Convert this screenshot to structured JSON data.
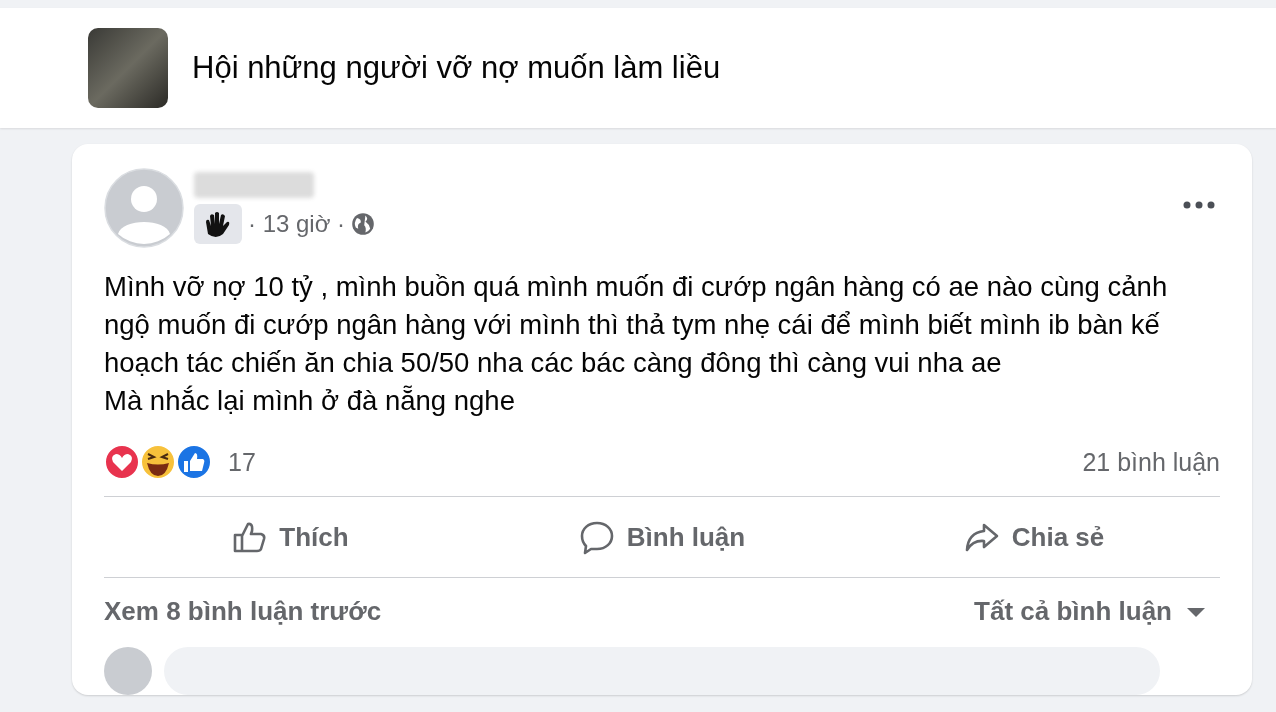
{
  "group": {
    "title": "Hội những người vỡ nợ muốn làm liều"
  },
  "post": {
    "time": "· 13 giờ ·",
    "paragraphs": [
      "Mình vỡ nợ 10 tỷ , mình buồn quá  mình muốn đi cướp ngân hàng có ae nào cùng cảnh ngộ muốn đi cướp ngân hàng với mình thì thả tym nhẹ cái để mình biết mình ib bàn kế hoạch tác chiến ăn chia 50/50 nha các bác càng đông thì càng vui nha ae",
      "Mà nhắc lại mình ở đà nẵng nghe"
    ],
    "reaction_count": "17",
    "comment_count": "21 bình luận",
    "actions": [
      {
        "kind": "like",
        "label": "Thích"
      },
      {
        "kind": "comment",
        "label": "Bình luận"
      },
      {
        "kind": "share",
        "label": "Chia sẻ"
      }
    ],
    "view_previous": "Xem 8 bình luận trước",
    "sort": "Tất cả bình luận"
  }
}
